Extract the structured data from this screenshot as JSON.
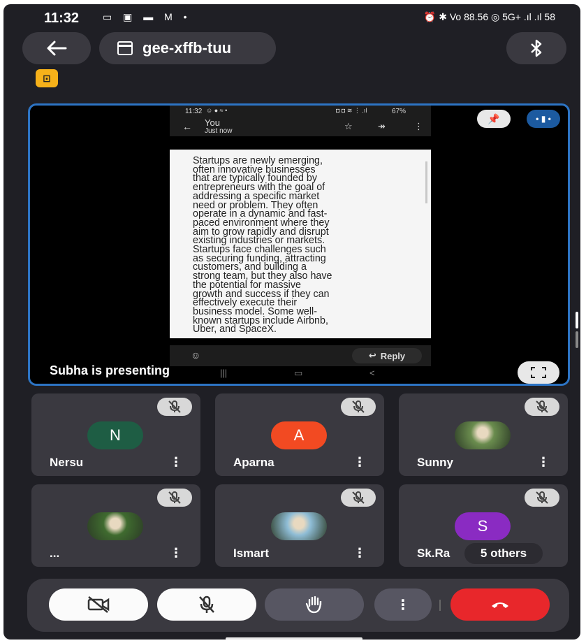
{
  "status_bar": {
    "time": "11:32",
    "left_icons": "▭ ▣ ▬ M •",
    "right_icons": "⏰ ✱ Vo 88.56 ◎ 5G+ .ıl .ıl 58"
  },
  "header": {
    "meeting_code": "gee-xffb-tuu",
    "back_icon": "arrow-left-icon",
    "bluetooth_icon": "bluetooth-icon",
    "badge_icon": "captions-icon"
  },
  "presentation": {
    "label": "Subha is presenting",
    "shared_screen": {
      "status_time": "11:32",
      "status_right": "67%",
      "chat_title": "You",
      "chat_subtitle": "Just now",
      "message": "Startups are newly emerging,\noften innovative businesses\nthat are typically founded by\nentrepreneurs with the goal of\naddressing a specific market\nneed or problem. They often\noperate in a dynamic and fast-\npaced environment where they\naim to grow rapidly and disrupt\nexisting industries or markets.\nStartups face challenges such\nas securing funding, attracting\ncustomers, and building a\nstrong team, but they also have\nthe potential for massive\ngrowth and success if they can\neffectively execute their\nbusiness model. Some well-\nknown startups include Airbnb,\nUber, and SpaceX.",
      "reply_label": "Reply"
    }
  },
  "participants": [
    {
      "name": "Nersu",
      "initial": "N",
      "color": "#1e5d44",
      "photo": false
    },
    {
      "name": "Aparna",
      "initial": "A",
      "color": "#f24a22",
      "photo": false
    },
    {
      "name": "Sunny",
      "initial": "",
      "color": "#6a8c4e",
      "photo": true
    },
    {
      "name": "...",
      "initial": "",
      "color": "#3f6b2f",
      "photo": true
    },
    {
      "name": "Ismart",
      "initial": "",
      "color": "#8fbdd6",
      "photo": true
    },
    {
      "name": "Sk.Ra",
      "initial": "S",
      "color": "#8a2bc2",
      "photo": false
    }
  ],
  "others_label": "5 others",
  "controls": {
    "camera_icon": "camera-off-icon",
    "mic_icon": "mic-off-icon",
    "hand_icon": "raise-hand-icon",
    "more_icon": "more-vertical-icon",
    "end_icon": "end-call-icon",
    "end_color": "#e8272b"
  }
}
